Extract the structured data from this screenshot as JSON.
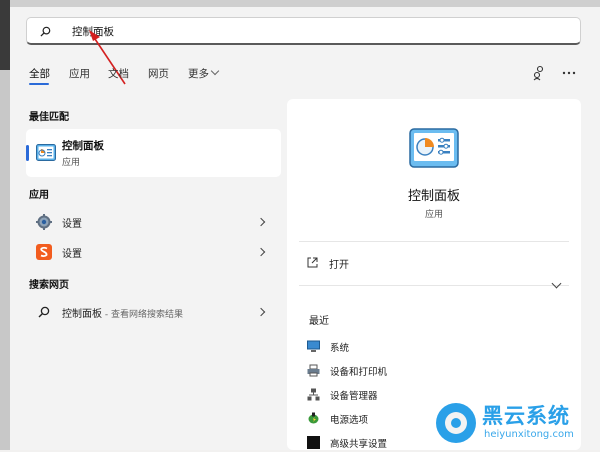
{
  "search": {
    "query": "控制面板"
  },
  "tabs": [
    {
      "label": "全部"
    },
    {
      "label": "应用"
    },
    {
      "label": "文档"
    },
    {
      "label": "网页"
    },
    {
      "label": "更多"
    }
  ],
  "best_match": {
    "section": "最佳匹配",
    "name": "控制面板",
    "type": "应用"
  },
  "apps": {
    "section": "应用",
    "items": [
      {
        "label": "设置",
        "icon": "gear-icon"
      },
      {
        "label": "设置",
        "icon": "sogou-s-icon"
      }
    ]
  },
  "web": {
    "section": "搜索网页",
    "item_label": "控制面板",
    "item_suffix": " - 查看网络搜索结果"
  },
  "detail": {
    "title": "控制面板",
    "subtitle": "应用",
    "open_label": "打开",
    "recent_label": "最近",
    "recent_items": [
      {
        "label": "系统"
      },
      {
        "label": "设备和打印机"
      },
      {
        "label": "设备管理器"
      },
      {
        "label": "电源选项"
      },
      {
        "label": "高级共享设置"
      }
    ]
  },
  "watermark": {
    "title": "黑云系统",
    "url": "heiyunxitong.com"
  },
  "colors": {
    "accent": "#2a6ad8",
    "watermark": "#2aa0e8",
    "arrow": "#d42020"
  }
}
